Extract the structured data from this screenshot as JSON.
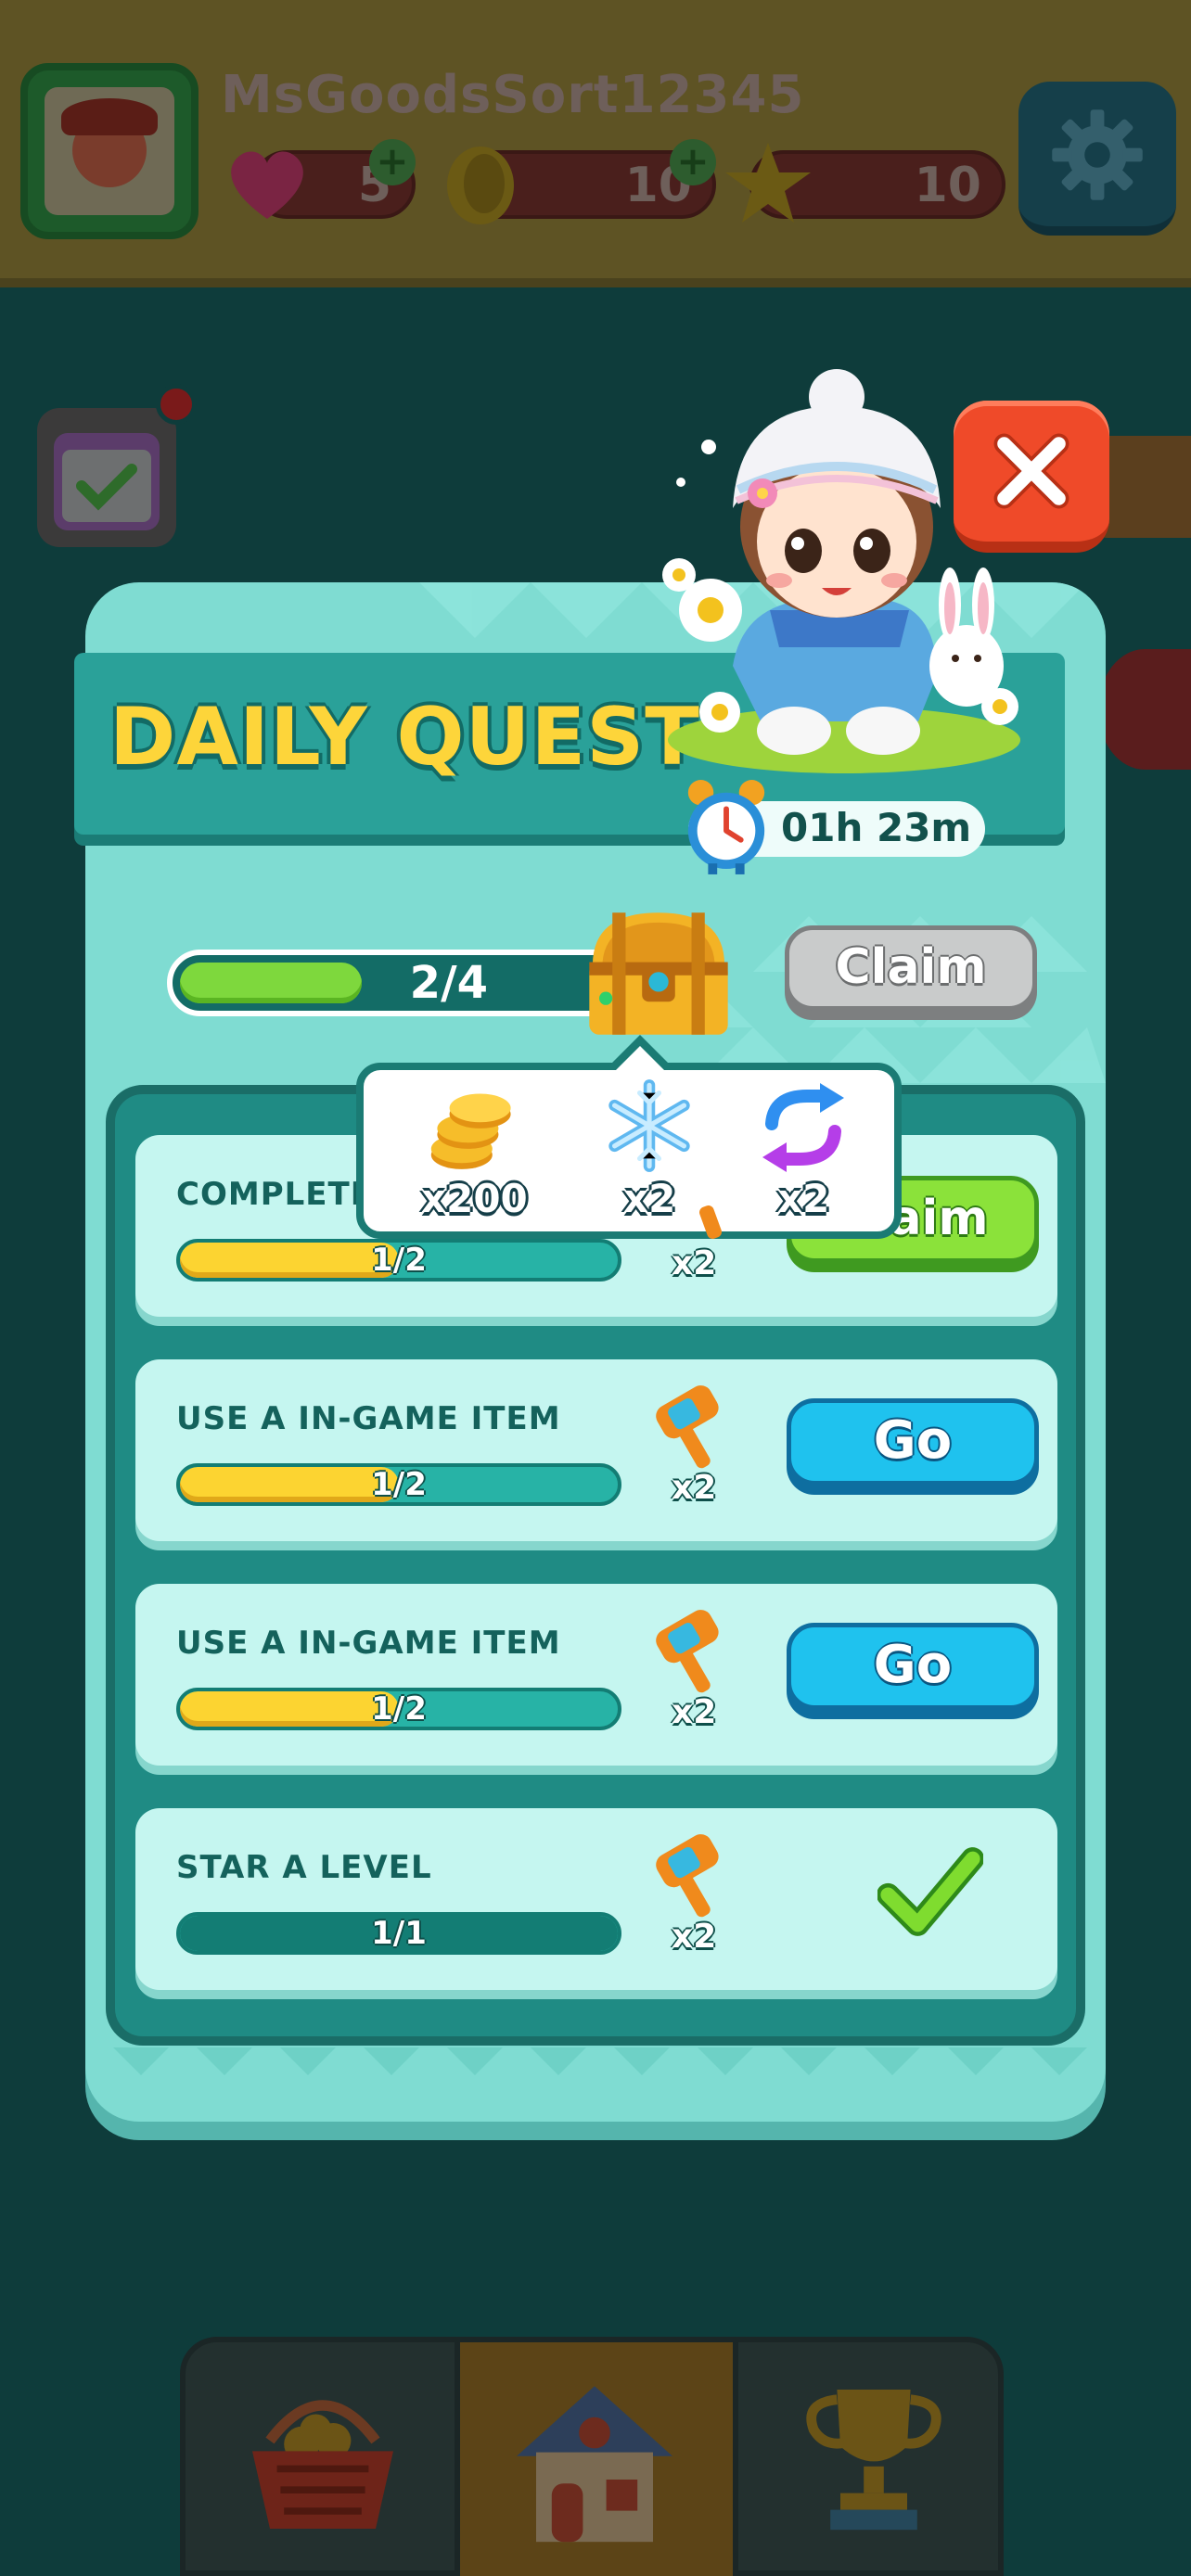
{
  "player": {
    "username": "MsGoodsSort12345",
    "lives": "5",
    "coins": "10",
    "stars": "10"
  },
  "quest_panel": {
    "title": "DAILY QUEST",
    "timer": "01h 23m",
    "progress_text": "2/4",
    "progress_fraction": 0.5,
    "chest_claim_label": "Claim"
  },
  "chest_rewards": [
    {
      "icon": "coin-stack-icon",
      "qty": "x200"
    },
    {
      "icon": "snowflake-icon",
      "qty": "x2"
    },
    {
      "icon": "shuffle-icon",
      "qty": "x2"
    }
  ],
  "quests": [
    {
      "label": "COMPLETE",
      "progress_text": "1/2",
      "progress_fraction": 0.5,
      "reward_icon": "hammer-icon",
      "reward_qty": "x2",
      "action": "claim",
      "action_label": "Claim"
    },
    {
      "label": "USE A IN-GAME ITEM",
      "progress_text": "1/2",
      "progress_fraction": 0.5,
      "reward_icon": "hammer-icon",
      "reward_qty": "x2",
      "action": "go",
      "action_label": "Go"
    },
    {
      "label": "USE A IN-GAME ITEM",
      "progress_text": "1/2",
      "progress_fraction": 0.5,
      "reward_icon": "hammer-icon",
      "reward_qty": "x2",
      "action": "go",
      "action_label": "Go"
    },
    {
      "label": "STAR A LEVEL",
      "progress_text": "1/1",
      "progress_fraction": 1.0,
      "reward_icon": "hammer-icon",
      "reward_qty": "x2",
      "action": "done",
      "action_label": ""
    }
  ],
  "bottom_nav": [
    {
      "icon": "basket-icon"
    },
    {
      "icon": "house-icon",
      "active": true
    },
    {
      "icon": "trophy-icon"
    }
  ],
  "colors": {
    "title_yellow": "#fdd53a",
    "panel_teal": "#7fdcd2",
    "go_blue": "#1fc2ee",
    "claim_green": "#8be23a",
    "close_red": "#ef4a29"
  }
}
